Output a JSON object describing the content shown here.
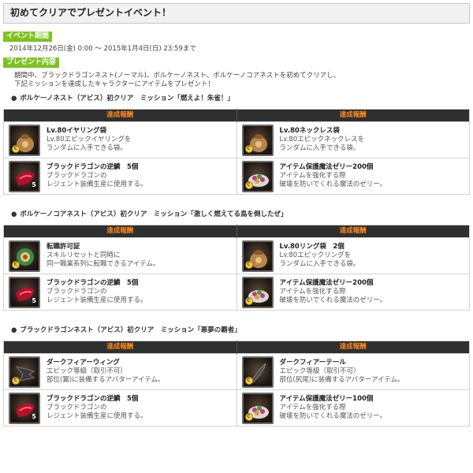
{
  "page": {
    "title": "初めてクリアでプレゼントイベント！",
    "period_tag": "イベント期間",
    "period_text": "2014年12月26日(金) 0:00 ～ 2015年1月4日(日) 23:59まで",
    "present_tag": "プレゼント内容",
    "intro_line1": "期間中、ブラックドラゴンネスト(ノーマル)、ボルケーノネスト、ボルケーノコアネストを初めてクリアし、",
    "intro_line2": "下記ミッションを達成したキャラクターにアイテムをプレゼント！",
    "bullet": "●"
  },
  "sections": [
    {
      "mission": "ボルケーノネスト（アビス）初クリア　ミッション「燃えよ！朱雀！」",
      "header_left": "達成報酬",
      "header_right": "達成報酬",
      "rows": [
        [
          {
            "name": "Lv.80イヤリング袋",
            "desc1": "Lv.80エピックイヤリングを",
            "desc2": "ランダムに入手できる袋。",
            "icon": "pouch-icon",
            "qty": "",
            "coin": true
          },
          {
            "name": "Lv.80ネックレス袋",
            "desc1": "Lv.80エピックネックレスを",
            "desc2": "ランダムに入手できる袋。",
            "icon": "pouch-icon",
            "qty": "",
            "coin": true
          }
        ],
        [
          {
            "name": "ブラックドラゴンの逆鱗　5個",
            "desc1": "ブラックドラゴンの",
            "desc2": "レジェント装備生産に使用する。",
            "icon": "scale-icon",
            "qty": "5",
            "coin": false
          },
          {
            "name": "アイテム保護魔法ゼリー200個",
            "desc1": "アイテムを強化する際",
            "desc2": "破壊を防いでくれる魔法のゼリー。",
            "icon": "jelly-icon",
            "qty": "",
            "coin": true
          }
        ]
      ]
    },
    {
      "mission": "ボルケーノコアネスト（アビス）初クリア　ミッション「激しく燃えてる鳥を倒したぜ」",
      "header_left": "達成報酬",
      "header_right": "達成報酬",
      "rows": [
        [
          {
            "name": "転職許可証",
            "desc1": "スキルリセットと同時に",
            "desc2": "同一職業系列に転職できるアイテム。",
            "icon": "certificate-icon",
            "qty": "",
            "coin": true
          },
          {
            "name": "Lv.80リング袋　2個",
            "desc1": "Lv.80エピックリングを",
            "desc2": "ランダムに入手できる袋。",
            "icon": "pouch-icon",
            "qty": "",
            "coin": true
          }
        ],
        [
          {
            "name": "ブラックドラゴンの逆鱗　5個",
            "desc1": "ブラックドラゴンの",
            "desc2": "レジェント装備生産に使用する。",
            "icon": "scale-icon",
            "qty": "5",
            "coin": false
          },
          {
            "name": "アイテム保護魔法ゼリー200個",
            "desc1": "アイテムを強化する際",
            "desc2": "破壊を防いでくれる魔法のゼリー。",
            "icon": "jelly-icon",
            "qty": "",
            "coin": true
          }
        ]
      ]
    },
    {
      "mission": "ブラックドラゴンネスト（アビス）初クリア　ミッション「悪夢の覇者」",
      "header_left": "達成報酬",
      "header_right": "達成報酬",
      "rows": [
        [
          {
            "name": "ダークフィアーウィング",
            "desc1": "エピック等級（取引不可）",
            "desc2": "部位(翼)に装備するアバターアイテム。",
            "icon": "wing-icon",
            "qty": "",
            "coin": true
          },
          {
            "name": "ダークフィアーテール",
            "desc1": "エピック等級（取引不可）",
            "desc2": "部位(尻尾)に装備するアバターアイテム。",
            "icon": "tail-icon",
            "qty": "",
            "coin": true
          }
        ],
        [
          {
            "name": "ブラックドラゴンの逆鱗　5個",
            "desc1": "ブラックドラゴンの",
            "desc2": "レジェント装備生産に使用する。",
            "icon": "scale-icon",
            "qty": "5",
            "coin": false
          },
          {
            "name": "アイテム保護魔法ゼリー100個",
            "desc1": "アイテムを強化する際",
            "desc2": "破壊を防いでくれる魔法のゼリー。",
            "icon": "jelly-icon",
            "qty": "",
            "coin": true
          }
        ]
      ]
    }
  ],
  "colors": {
    "tag_green": "#7cc31f",
    "header_bg": "#2f2f2f",
    "header_text": "#ff8a1c"
  }
}
